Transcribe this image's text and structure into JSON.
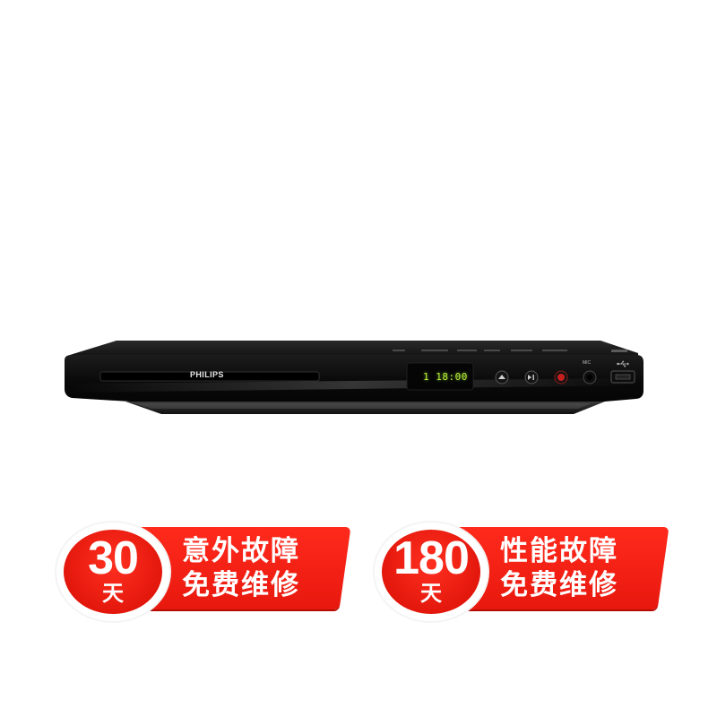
{
  "product": {
    "brand": "PHILIPS",
    "display_readout": "1 18:00",
    "mic_label": "MIC",
    "display_color": "#b9f23a"
  },
  "badges": [
    {
      "number": "30",
      "unit": "天",
      "line1": "意外故障",
      "line2": "免费维修",
      "color": "#ff2a1c"
    },
    {
      "number": "180",
      "unit": "天",
      "line1": "性能故障",
      "line2": "免费维修",
      "color": "#ff2a1c"
    }
  ]
}
